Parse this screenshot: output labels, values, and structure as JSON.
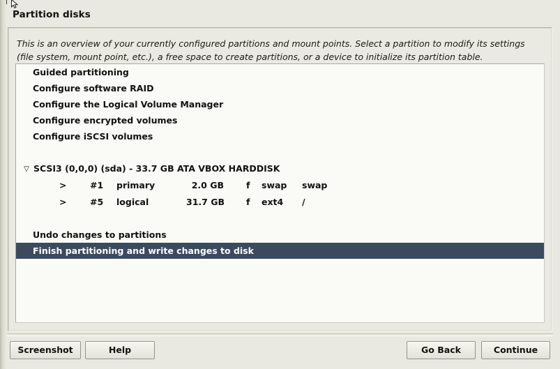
{
  "window": {
    "title": "Partition disks"
  },
  "description": {
    "line1": "This is an overview of your currently configured partitions and mount points. Select a partition to modify its settings",
    "line2": "(file system, mount point, etc.), a free space to create partitions, or a device to initialize its partition table."
  },
  "colors": {
    "selection_background": "#3b4a5e",
    "selection_text": "#ffffff",
    "list_background": "#fafbf7",
    "window_background": "#e9e9e1"
  },
  "list": {
    "top_actions": [
      {
        "label": "Guided partitioning"
      },
      {
        "label": "Configure software RAID"
      },
      {
        "label": "Configure the Logical Volume Manager"
      },
      {
        "label": "Configure encrypted volumes"
      },
      {
        "label": "Configure iSCSI volumes"
      }
    ],
    "disk": {
      "expander_icon": "triangle-down-icon",
      "expander_glyph": "▽",
      "label": "SCSI3 (0,0,0) (sda) - 33.7 GB ATA VBOX HARDDISK",
      "partitions": [
        {
          "marker": ">",
          "number": "#1",
          "type": "primary",
          "size": "2.0 GB",
          "flags": "f",
          "filesystem": "swap",
          "mountpoint": "swap"
        },
        {
          "marker": ">",
          "number": "#5",
          "type": "logical",
          "size": "31.7 GB",
          "flags": "f",
          "filesystem": "ext4",
          "mountpoint": "/"
        }
      ]
    },
    "bottom_actions": [
      {
        "label": "Undo changes to partitions",
        "selected": false
      },
      {
        "label": "Finish partitioning and write changes to disk",
        "selected": true
      }
    ]
  },
  "buttons": {
    "screenshot": "Screenshot",
    "help": "Help",
    "go_back": "Go Back",
    "continue": "Continue"
  }
}
